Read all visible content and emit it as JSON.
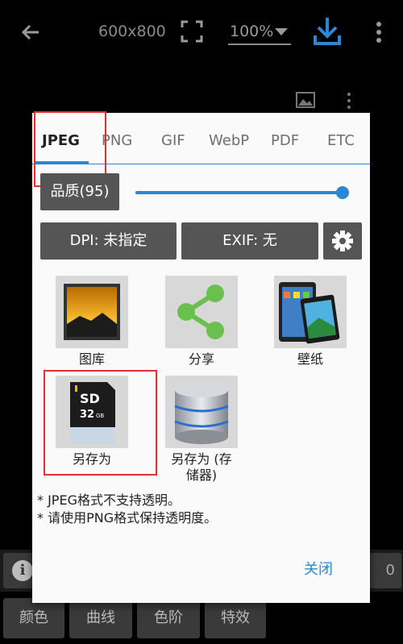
{
  "topbar": {
    "dimensions": "600x800",
    "zoom": "100%",
    "icons": [
      "back-arrow-icon",
      "fit-screen-icon",
      "download-icon",
      "more-vert-icon"
    ]
  },
  "dialog": {
    "tabs": [
      "JPEG",
      "PNG",
      "GIF",
      "WebP",
      "PDF",
      "ETC"
    ],
    "active_tab": "JPEG",
    "quality_label": "品质(95)",
    "quality_value": 95,
    "dpi_button": "DPI: 未指定",
    "exif_button": "EXIF: 无",
    "actions": [
      {
        "label": "图库",
        "icon": "gallery-icon"
      },
      {
        "label": "分享",
        "icon": "share-icon"
      },
      {
        "label": "壁纸",
        "icon": "wallpaper-icon"
      },
      {
        "label": "另存为",
        "icon": "sd-card-icon"
      },
      {
        "label": "另存为 (存储器)",
        "icon": "storage-icon"
      }
    ],
    "sd_card": {
      "brand": "SD",
      "capacity": "32",
      "unit": "GB"
    },
    "notes": [
      "* JPEG格式不支持透明。",
      "* 请使用PNG格式保持透明度。"
    ],
    "close_button": "关闭"
  },
  "bottom": {
    "tools": [
      "颜色",
      "曲线",
      "色阶",
      "特效"
    ],
    "right_count": "0"
  },
  "colors": {
    "accent": "#2a87d4",
    "highlight": "#e03030",
    "button": "#555555"
  }
}
